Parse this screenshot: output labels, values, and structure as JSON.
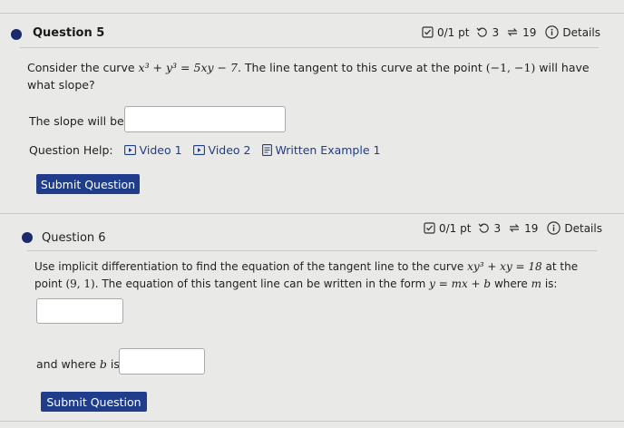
{
  "questions": [
    {
      "title": "Question 5",
      "score": "0/1 pt",
      "retries": "3",
      "attempts": "19",
      "details_label": "Details",
      "prompt_pre": "Consider the curve",
      "equation": "x³ + y³ = 5xy − 7",
      "prompt_mid": ". The line tangent to this curve at the point",
      "point": "(−1, −1)",
      "prompt_post": "will have",
      "prompt_line2": "what slope?",
      "answer_label": "The slope will be",
      "help_label": "Question Help:",
      "help_links": [
        "Video 1",
        "Video 2",
        "Written Example 1"
      ],
      "submit_label": "Submit Question"
    },
    {
      "title": "Question 6",
      "score": "0/1 pt",
      "retries": "3",
      "attempts": "19",
      "details_label": "Details",
      "prompt_pre": "Use implicit differentiation to find the equation of the tangent line to the curve",
      "equation": "xy³ + xy = 18",
      "prompt_post": "at the",
      "line2_pre": "point",
      "point": "(9, 1)",
      "line2_mid": ". The equation of this tangent line can be written in the form",
      "form": "y = mx + b",
      "line2_post": "where",
      "m_var": "m",
      "line2_end": "is:",
      "b_label_pre": "and where",
      "b_var": "b",
      "b_label_post": "is:",
      "submit_label": "Submit Question"
    }
  ]
}
